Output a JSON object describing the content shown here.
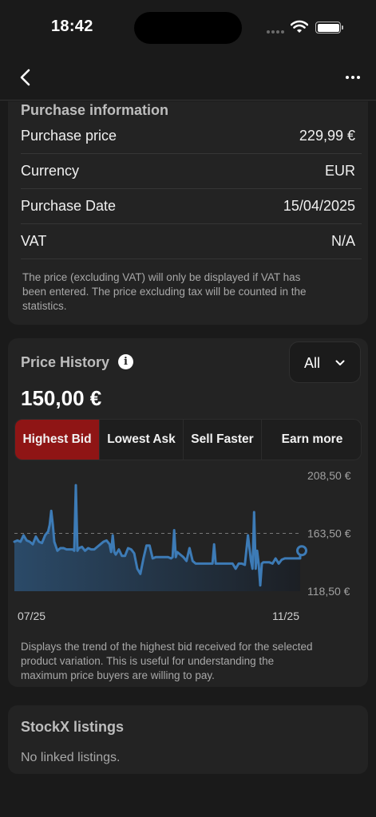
{
  "status_bar": {
    "time": "18:42"
  },
  "nav": {
    "back_icon": "chevron-left-icon",
    "more_icon": "ellipsis-icon"
  },
  "purchase": {
    "title": "Purchase information",
    "rows": [
      {
        "label": "Purchase price",
        "value": "229,99 €"
      },
      {
        "label": "Currency",
        "value": "EUR"
      },
      {
        "label": "Purchase Date",
        "value": "15/04/2025"
      },
      {
        "label": "VAT",
        "value": "N/A"
      }
    ],
    "note_lines": [
      "The price (excluding VAT) will only be displayed if VAT has",
      "been entered. The price excluding tax will be counted in the",
      "statistics."
    ]
  },
  "price_history": {
    "title": "Price History",
    "info_icon": "info-icon",
    "range": "All",
    "current_price": "150,00 €",
    "tabs": [
      {
        "label": "Highest Bid",
        "active": true
      },
      {
        "label": "Lowest Ask",
        "active": false
      },
      {
        "label": "Sell Faster",
        "active": false
      },
      {
        "label": "Earn more",
        "active": false
      }
    ],
    "note_lines": [
      "Displays the trend of the highest bid received for the selected",
      "product variation. This is useful for understanding the",
      "maximum price buyers are willing to pay."
    ]
  },
  "chart_data": {
    "type": "area",
    "x_tick_labels": [
      "07/25",
      "11/25"
    ],
    "y_tick_labels": [
      "208,50 €",
      "163,50 €",
      "118,50 €"
    ],
    "ylim": [
      118.5,
      208.5
    ],
    "reference_line": 163.5,
    "values": [
      157,
      158,
      157,
      162,
      158,
      157,
      155,
      161,
      157,
      156,
      162,
      165,
      170,
      157,
      150,
      152,
      152,
      151,
      151,
      151,
      150,
      152,
      153,
      150,
      152,
      151,
      151,
      153,
      155,
      157,
      158,
      155,
      149,
      147,
      151,
      146,
      146,
      152,
      151,
      148,
      136,
      132,
      144,
      154,
      154,
      144,
      145,
      145,
      145,
      145,
      145,
      144,
      145,
      149,
      147,
      145,
      142,
      152,
      142,
      140,
      140,
      140,
      140,
      140,
      140,
      140,
      140,
      140,
      140,
      140,
      140,
      140,
      136,
      140,
      140,
      139,
      162,
      142,
      136,
      150,
      140,
      141,
      141,
      141,
      140,
      144,
      140,
      143,
      144,
      144,
      144,
      144,
      144,
      144
    ],
    "spikes": [
      {
        "index": 12,
        "value": 181
      },
      {
        "index": 20,
        "value": 201
      },
      {
        "index": 32,
        "value": 162
      },
      {
        "index": 52,
        "value": 166
      },
      {
        "index": 65,
        "value": 155
      },
      {
        "index": 78,
        "value": 180
      },
      {
        "index": 80,
        "value": 123
      }
    ],
    "last_value": 150,
    "line_color": "#3d7bb6",
    "grid": false
  },
  "stockx": {
    "title": "StockX listings",
    "empty_text": "No linked listings."
  }
}
